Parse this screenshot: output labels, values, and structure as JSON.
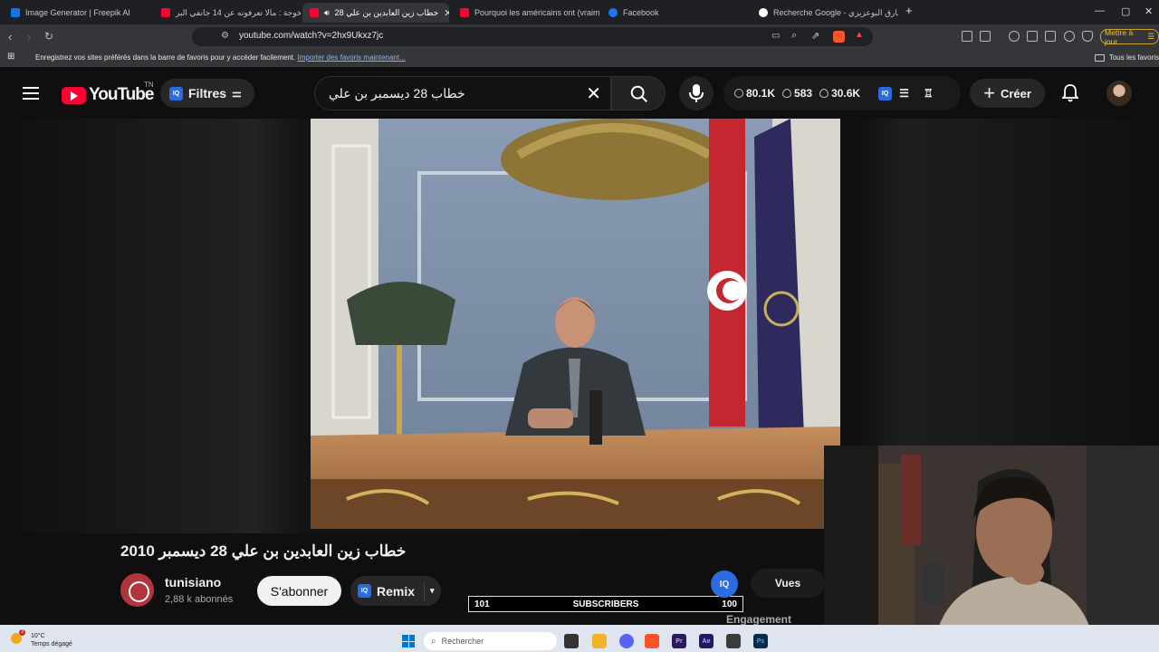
{
  "browser": {
    "tabs": [
      {
        "title": "Image Generator | Freepik AI",
        "favicon_color": "#1273eb",
        "active": false
      },
      {
        "title": "بالخوجة : مالا تعرفونه عن 14 جانفي البر",
        "favicon_color": "#ff0033",
        "active": false
      },
      {
        "title": "خطاب زين العابدين بن علي 28",
        "favicon_color": "#ff0033",
        "active": true
      },
      {
        "title": "Pourquoi les américains ont (vraimen",
        "favicon_color": "#ff0033",
        "active": false
      },
      {
        "title": "Facebook",
        "favicon_color": "#1877f2",
        "active": false
      },
      {
        "title": "Recherche Google - طارق البوعزيزي",
        "favicon_color": "#ffffff",
        "active": false
      }
    ],
    "new_tab_label": "+",
    "url": "youtube.com/watch?v=2hx9Ukxz7jc",
    "update_button_label": "Mettre à jour",
    "bookmarks_bar": {
      "message": "Enregistrez vos sites préférés dans la barre de favoris pour y accéder facilement.",
      "import_link": "Importer des favoris maintenant...",
      "all_favorites": "Tous les favoris"
    }
  },
  "youtube": {
    "logo_text": "YouTube",
    "country_code": "TN",
    "filters_label": "Filtres",
    "iq_label": "IQ",
    "search_query": "خطاب 28 ديسمبر بن علي",
    "stats": [
      {
        "icon": "clock-icon",
        "value": "80.1K"
      },
      {
        "icon": "eye-icon",
        "value": "583"
      },
      {
        "icon": "eye-icon",
        "value": "30.6K"
      }
    ],
    "create_label": "Créer",
    "video_title": "خطاب زين العابدين بن علي 28 ديسمبر 2010",
    "channel": {
      "name": "tunisiano",
      "subscribers": "2,88 k abonnés"
    },
    "subscribe_label": "S'abonner",
    "remix_label": "Remix",
    "subscriber_counter": {
      "left_value": "101",
      "label": "SUBSCRIBERS",
      "right_value": "100"
    },
    "vues_label": "Vues",
    "engagement_label": "Engagement"
  },
  "taskbar": {
    "weather_temp": "10°C",
    "weather_desc": "Temps dégagé",
    "weather_badge": "3",
    "search_placeholder": "Rechercher",
    "apps": [
      {
        "name": "Pr",
        "color": "#2b1a5e"
      },
      {
        "name": "Ae",
        "color": "#1f1a5e"
      },
      {
        "name": "Ps",
        "color": "#0a2a4a"
      }
    ]
  }
}
